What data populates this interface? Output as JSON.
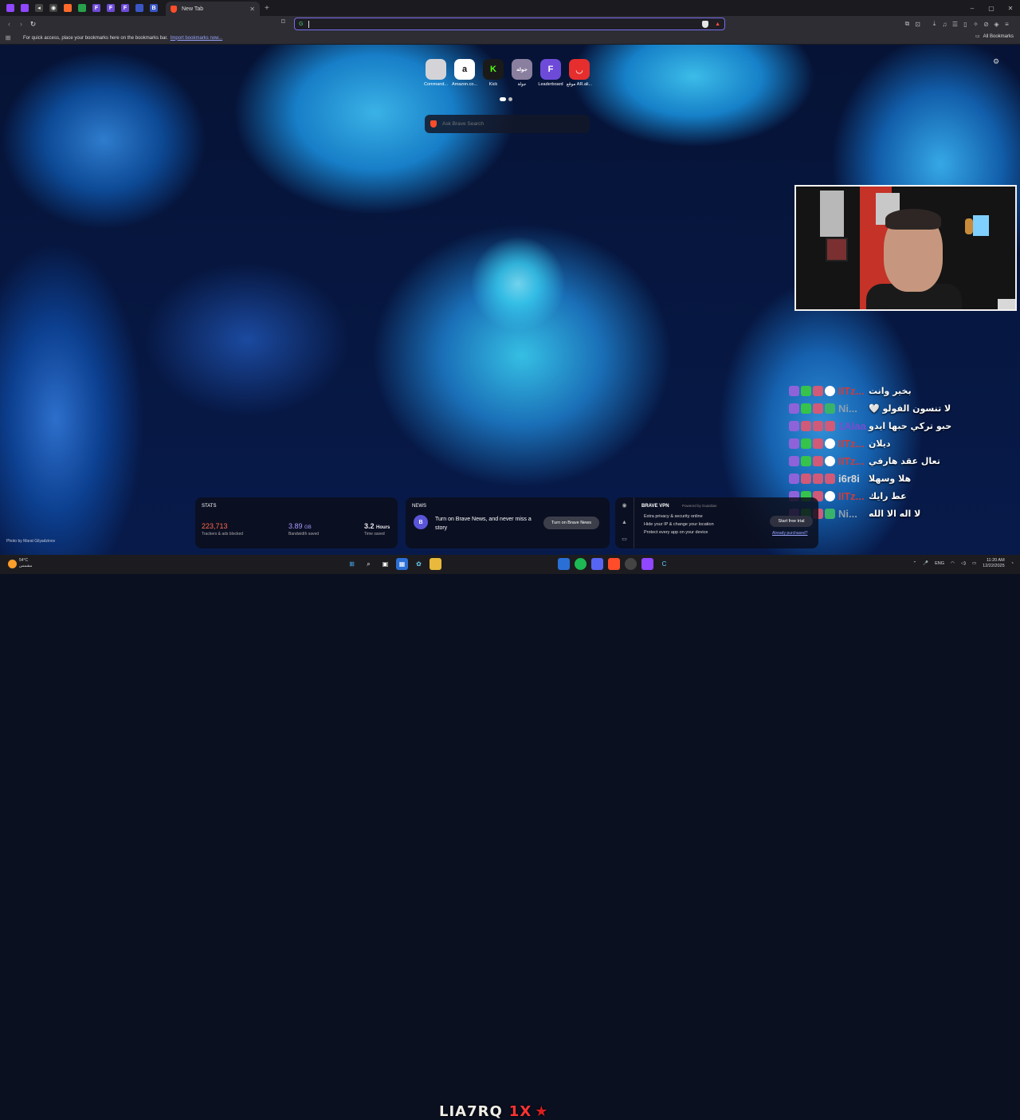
{
  "tabs": {
    "pinned": [
      {
        "name": "twitch",
        "color": "#9146ff",
        "glyph": ""
      },
      {
        "name": "twitch-2",
        "color": "#9146ff",
        "glyph": ""
      },
      {
        "name": "audio",
        "color": "#444",
        "glyph": "◂"
      },
      {
        "name": "chrome",
        "color": "#444",
        "glyph": "◉"
      },
      {
        "name": "brave",
        "color": "#ff6a2a",
        "glyph": ""
      },
      {
        "name": "game",
        "color": "#27a14a",
        "glyph": ""
      },
      {
        "name": "f1",
        "color": "#6d4bd8",
        "glyph": "F"
      },
      {
        "name": "f2",
        "color": "#6d4bd8",
        "glyph": "F"
      },
      {
        "name": "f3",
        "color": "#6d4bd8",
        "glyph": "F"
      },
      {
        "name": "controller",
        "color": "#3a56c6",
        "glyph": ""
      },
      {
        "name": "b",
        "color": "#3a56c6",
        "glyph": "B"
      }
    ],
    "active_title": "New Tab"
  },
  "window_controls": {
    "minimize": "–",
    "maximize": "▢",
    "close": "✕"
  },
  "toolbar": {
    "url_value": "",
    "engine_letter": "G"
  },
  "bookmarks_bar": {
    "text": "For quick access, place your bookmarks here on the bookmarks bar.",
    "link": "Import bookmarks now...",
    "all_bookmarks": "All Bookmarks"
  },
  "top_sites": [
    {
      "label": "Command...",
      "glyph": "",
      "bg": "#d4d4d8"
    },
    {
      "label": "Amazon.co...",
      "glyph": "a",
      "bg": "#ffffff"
    },
    {
      "label": "Kick",
      "glyph": "K",
      "bg": "#1a1a1a"
    },
    {
      "label": "جولة",
      "glyph": "جولة",
      "bg": "#8a7f9f"
    },
    {
      "label": "Leaderboard",
      "glyph": "F",
      "bg": "#6d4bd8"
    },
    {
      "label": "موقع AR.ali...",
      "glyph": "◡",
      "bg": "#e62e2e"
    }
  ],
  "search": {
    "placeholder": "Ask Brave Search"
  },
  "chat": [
    {
      "name": "IITz...",
      "color": "#d03c3c",
      "badges": [
        "twitch",
        "green",
        "gift",
        "check"
      ],
      "msg": "بخير وانت"
    },
    {
      "name": "Ni...",
      "color": "#8a9fb0",
      "badges": [
        "twitch",
        "green",
        "gift",
        "sub"
      ],
      "msg": "لا تنسون الفولو 🤍"
    },
    {
      "name": "1Alaa",
      "color": "#7a4bd0",
      "badges": [
        "twitch",
        "gift",
        "gift",
        "gift"
      ],
      "msg": "حبو تركي حبها ايدو"
    },
    {
      "name": "IITz...",
      "color": "#d03c3c",
      "badges": [
        "twitch",
        "green",
        "gift",
        "check"
      ],
      "msg": "ديلان"
    },
    {
      "name": "IITz...",
      "color": "#d03c3c",
      "badges": [
        "twitch",
        "green",
        "gift",
        "check"
      ],
      "msg": "تعال عقد هارفي"
    },
    {
      "name": "i6r8i",
      "color": "#d6d6d6",
      "badges": [
        "twitch",
        "gift",
        "gift",
        "gift"
      ],
      "msg": "هلا وسهلا"
    },
    {
      "name": "IITz...",
      "color": "#d03c3c",
      "badges": [
        "twitch",
        "green",
        "gift",
        "check"
      ],
      "msg": "عط رايك"
    },
    {
      "name": "Ni...",
      "color": "#8a9fb0",
      "badges": [
        "twitch",
        "green",
        "gift",
        "sub"
      ],
      "msg": "لا اله الا الله"
    }
  ],
  "stats": {
    "title": "STATS",
    "trackers": "223,713",
    "trackers_label": "Trackers & ads blocked",
    "trackers_color": "#ff6b4a",
    "bandwidth": "3.89",
    "bandwidth_unit": "GB",
    "bandwidth_label": "Bandwidth saved",
    "bandwidth_color": "#a99cff",
    "time": "3.2",
    "time_unit": "Hours",
    "time_label": "Time saved"
  },
  "news": {
    "title": "NEWS",
    "text": "Turn on Brave News, and never miss a story",
    "button": "Turn on Brave News",
    "icon": "B"
  },
  "vpn": {
    "title": "BRAVE VPN",
    "powered": "Powered by  Guardian",
    "features": [
      "Extra privacy & security online",
      "Hide your IP & change your location",
      "Protect every app on your device"
    ],
    "button": "Start free trial",
    "link": "Already purchased?"
  },
  "photo_credit": "Photo by Marat Gilyadzinov",
  "weather": {
    "temp": "54°C",
    "desc": "مشمس"
  },
  "watermark": {
    "part1": "LIA7RQ",
    "part2": "1X",
    "part3": "★"
  },
  "tray": {
    "lang": "ENG",
    "time": "11:20 AM",
    "date": "12/22/2025"
  },
  "colors": {
    "accent": "#7a6cf0",
    "brave_orange": "#ff4d2a"
  }
}
